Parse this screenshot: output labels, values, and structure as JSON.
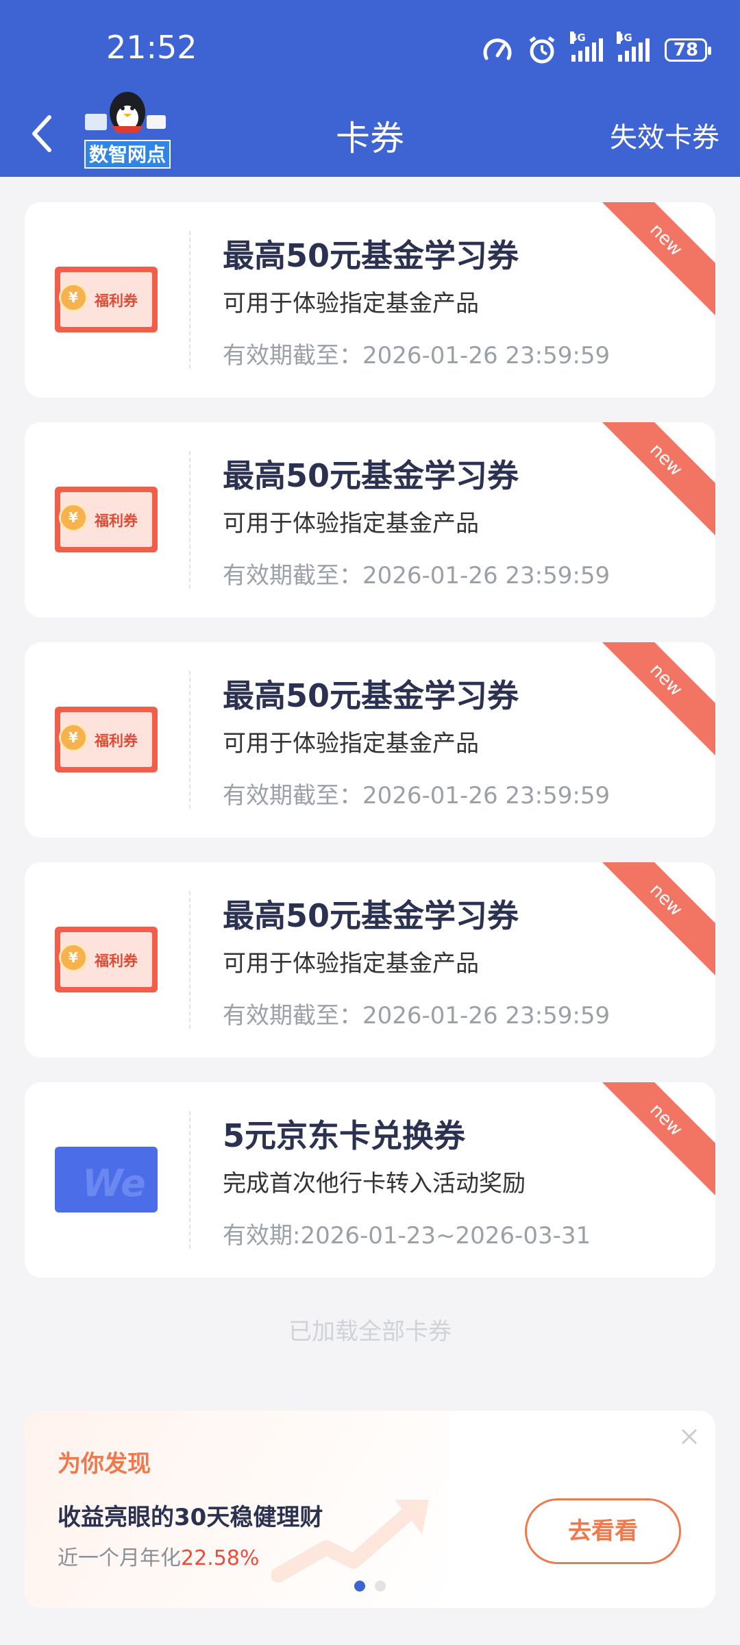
{
  "status_bar": {
    "time": "21:52",
    "signal_1": "4G",
    "signal_2": "4G",
    "battery": "78"
  },
  "header": {
    "logo_text": "数智网点",
    "title": "卡券",
    "expired_link": "失效卡券"
  },
  "coupons": [
    {
      "title": "最高50元基金学习券",
      "desc": "可用于体验指定基金产品",
      "expiry": "有效期截至：2026-01-26 23:59:59",
      "badge": "new",
      "thumb_label": "福利券"
    },
    {
      "title": "最高50元基金学习券",
      "desc": "可用于体验指定基金产品",
      "expiry": "有效期截至：2026-01-26 23:59:59",
      "badge": "new",
      "thumb_label": "福利券"
    },
    {
      "title": "最高50元基金学习券",
      "desc": "可用于体验指定基金产品",
      "expiry": "有效期截至：2026-01-26 23:59:59",
      "badge": "new",
      "thumb_label": "福利券"
    },
    {
      "title": "最高50元基金学习券",
      "desc": "可用于体验指定基金产品",
      "expiry": "有效期截至：2026-01-26 23:59:59",
      "badge": "new",
      "thumb_label": "福利券"
    },
    {
      "title": "5元京东卡兑换券",
      "desc": "完成首次他行卡转入活动奖励",
      "expiry": "有效期:2026-01-23~2026-03-31",
      "badge": "new",
      "thumb_label": "We"
    }
  ],
  "loaded_all_text": "已加载全部卡券",
  "promo": {
    "label": "为你发现",
    "title": "收益亮眼的30天稳健理财",
    "sub_prefix": "近一个月年化",
    "rate": "22.58%",
    "button": "去看看"
  },
  "colors": {
    "header_blue": "#3e63d2",
    "ribbon_red": "#f27563",
    "accent_orange": "#f0784d",
    "rate_red": "#ef4c38"
  }
}
